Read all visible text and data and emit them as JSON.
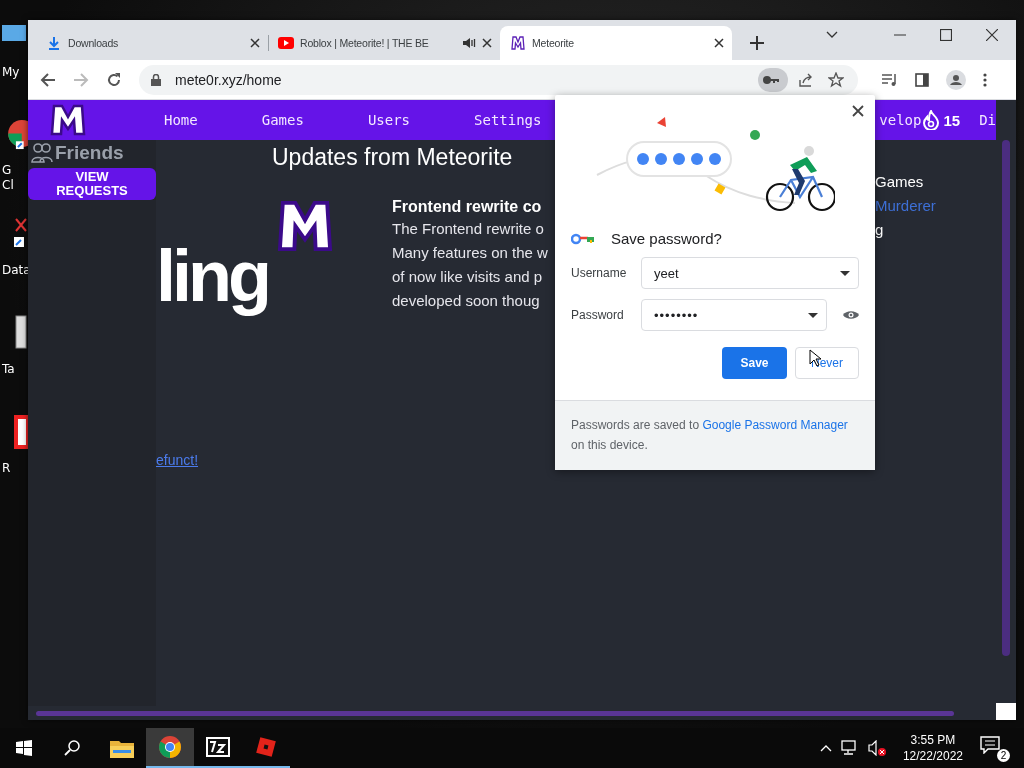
{
  "desktop": {
    "icons": [
      {
        "lines": [
          "My"
        ],
        "kind": "pc"
      },
      {
        "lines": [
          "G",
          "Cl"
        ],
        "kind": "chrome"
      },
      {
        "lines": [
          "Data"
        ],
        "kind": "shortcut"
      },
      {
        "lines": [
          "Ta"
        ],
        "kind": "file"
      },
      {
        "lines": [
          "R"
        ],
        "kind": "roblox"
      }
    ]
  },
  "browser": {
    "tabs": [
      {
        "title": "Downloads",
        "kind": "download",
        "audio": false,
        "selected": false
      },
      {
        "title": "Roblox | Meteorite! | THE BE",
        "kind": "youtube",
        "audio": true,
        "selected": false
      },
      {
        "title": "Meteorite",
        "kind": "meteorite",
        "audio": false,
        "selected": true
      }
    ],
    "forward_enabled": false,
    "address": "mete0r.xyz/home",
    "password_key_active": true
  },
  "site": {
    "nav": {
      "items": [
        "Home",
        "Games",
        "Users",
        "Settings"
      ],
      "right_items": [
        "velop"
      ],
      "streak": "15",
      "trailing": "Di"
    },
    "sidebar": {
      "heading": "Friends",
      "button": "VIEW REQUESTS"
    },
    "heading": "Updates from Meteorite",
    "banner_text": "ling",
    "post": {
      "title": "Frontend rewrite co",
      "lines": [
        "The Frontend rewrite o",
        "Many features on the w",
        "of now like visits and p",
        "developed soon thoug"
      ]
    },
    "link": "efunct!",
    "right_column": [
      {
        "text": "Games",
        "link": false
      },
      {
        "text": "Murderer",
        "link": true
      },
      {
        "text": "g",
        "link": false
      }
    ]
  },
  "popup": {
    "title": "Save password?",
    "fields": [
      {
        "label": "Username",
        "value": "yeet",
        "kind": "text"
      },
      {
        "label": "Password",
        "value": "••••••••",
        "kind": "password"
      }
    ],
    "buttons": [
      {
        "label": "Save",
        "primary": true
      },
      {
        "label": "Never",
        "primary": false
      }
    ],
    "footer": {
      "before": "Passwords are saved to",
      "link": "Google Password Manager",
      "after": "on this device."
    }
  },
  "taskbar": {
    "apps": [
      {
        "kind": "explorer",
        "running": false,
        "active": false
      },
      {
        "kind": "chrome",
        "running": true,
        "active": true
      },
      {
        "kind": "sevenzip",
        "running": true,
        "active": false
      },
      {
        "kind": "roblox",
        "running": true,
        "active": false
      }
    ],
    "time": "3:55 PM",
    "date": "12/22/2022",
    "notifications": "2",
    "volume_muted": true
  }
}
